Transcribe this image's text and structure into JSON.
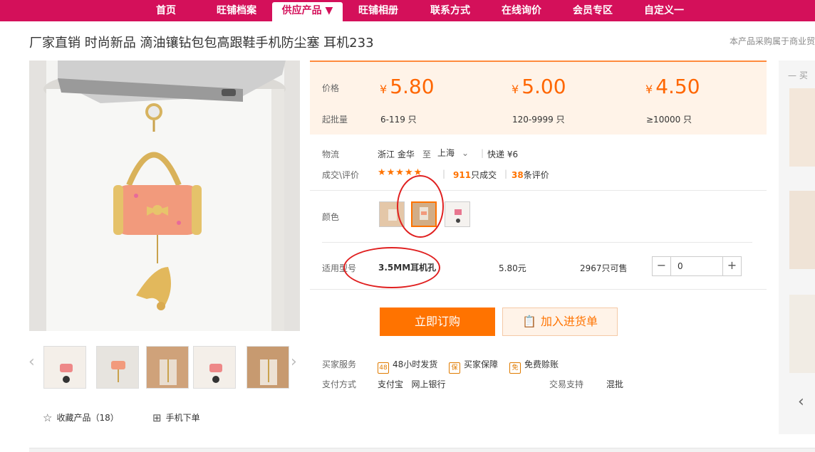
{
  "nav": {
    "items": [
      {
        "label": "首页"
      },
      {
        "label": "旺铺档案"
      },
      {
        "label": "供应产品 ▼"
      },
      {
        "label": "旺铺相册"
      },
      {
        "label": "联系方式"
      },
      {
        "label": "在线询价"
      },
      {
        "label": "会员专区"
      },
      {
        "label": "自定义一"
      }
    ],
    "active_index": 2,
    "color": "#d4105a"
  },
  "product": {
    "title": "厂家直销 时尚新品 滴油镶钻包包高跟鞋手机防尘塞 耳机233",
    "notice": "本产品采购属于商业贸"
  },
  "price_box": {
    "price_label": "价格",
    "qty_label": "起批量",
    "currency": "¥",
    "tiers": [
      {
        "price": "5.80",
        "qty": "6-119 只"
      },
      {
        "price": "5.00",
        "qty": "120-9999 只"
      },
      {
        "price": "4.50",
        "qty": "≥10000 只"
      }
    ],
    "accent": "#ff7300"
  },
  "logistics": {
    "label": "物流",
    "from": "浙江 金华",
    "to_word": "至",
    "to": "上海",
    "shipping": "快递 ¥6"
  },
  "trade": {
    "label": "成交\\评价",
    "stars": "★★★★★",
    "deals": "911",
    "deals_suffix": "只成交",
    "reviews": "38",
    "reviews_suffix": "条评价"
  },
  "color": {
    "label": "颜色",
    "selected_index": 1,
    "options": 3
  },
  "spec": {
    "label": "适用型号",
    "model": "3.5MM耳机孔",
    "price": "5.80元",
    "stock": "2967只可售",
    "quantity": "0",
    "minus": "−",
    "plus": "+"
  },
  "actions": {
    "buy": "立即订购",
    "cart": "加入进货单"
  },
  "services": {
    "label": "买家服务",
    "items": [
      {
        "icon": "48",
        "text": "48小时发货"
      },
      {
        "icon": "保",
        "text": "买家保障"
      },
      {
        "icon": "免",
        "text": "免费赊账"
      }
    ]
  },
  "payment": {
    "label": "支付方式",
    "methods": "支付宝   网上银行",
    "trade_label": "交易支持",
    "trade_value": "混批"
  },
  "gallery": {
    "left_arrow": "‹",
    "right_arrow": "›",
    "thumb_count": 5
  },
  "bottom": {
    "favorite": "收藏产品（18）",
    "mobile": "手机下单"
  },
  "side": {
    "head": "— 买",
    "arrow": "‹"
  }
}
